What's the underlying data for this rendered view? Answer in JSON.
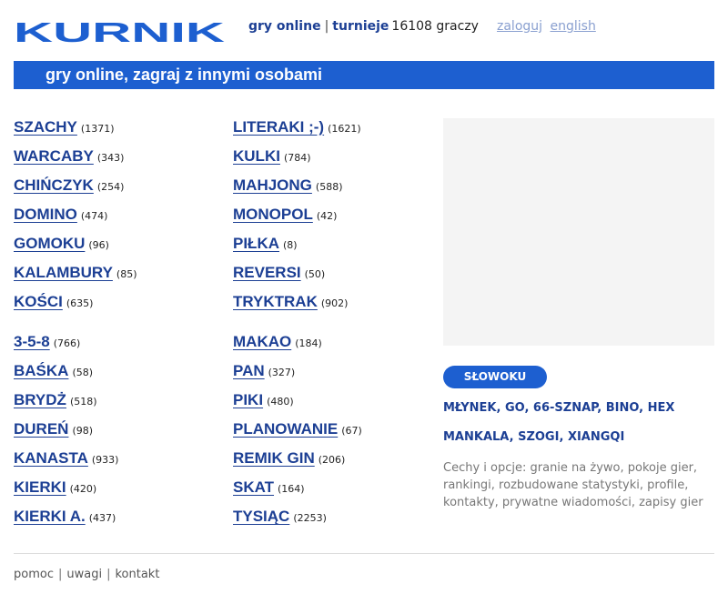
{
  "header": {
    "logo_text": "KURNIK",
    "nav_games": "gry online",
    "nav_separator": "|",
    "nav_tournaments": "turnieje",
    "players_count": "16108 graczy",
    "login": "zaloguj",
    "english": "english"
  },
  "banner": {
    "title": "gry online, zagraj z innymi osobami"
  },
  "games_left": [
    {
      "name": "SZACHY",
      "count": "(1371)"
    },
    {
      "name": "WARCABY",
      "count": "(343)"
    },
    {
      "name": "CHIŃCZYK",
      "count": "(254)"
    },
    {
      "name": "DOMINO",
      "count": "(474)"
    },
    {
      "name": "GOMOKU",
      "count": "(96)"
    },
    {
      "name": "KALAMBURY",
      "count": "(85)"
    },
    {
      "name": "KOŚCI",
      "count": "(635)"
    },
    {
      "name": "3-5-8",
      "count": "(766)"
    },
    {
      "name": "BAŚKA",
      "count": "(58)"
    },
    {
      "name": "BRYDŻ",
      "count": "(518)"
    },
    {
      "name": "DUREŃ",
      "count": "(98)"
    },
    {
      "name": "KANASTA",
      "count": "(933)"
    },
    {
      "name": "KIERKI",
      "count": "(420)"
    },
    {
      "name": "KIERKI A.",
      "count": "(437)"
    }
  ],
  "games_right": [
    {
      "name": "LITERAKI ;-)",
      "count": "(1621)"
    },
    {
      "name": "KULKI",
      "count": "(784)"
    },
    {
      "name": "MAHJONG",
      "count": "(588)"
    },
    {
      "name": "MONOPOL",
      "count": "(42)"
    },
    {
      "name": "PIŁKA",
      "count": "(8)"
    },
    {
      "name": "REVERSI",
      "count": "(50)"
    },
    {
      "name": "TRYKTRAK",
      "count": "(902)"
    },
    {
      "name": "MAKAO",
      "count": "(184)"
    },
    {
      "name": "PAN",
      "count": "(327)"
    },
    {
      "name": "PIKI",
      "count": "(480)"
    },
    {
      "name": "PLANOWANIE",
      "count": "(67)"
    },
    {
      "name": "REMIK GIN",
      "count": "(206)"
    },
    {
      "name": "SKAT",
      "count": "(164)"
    },
    {
      "name": "TYSIĄC",
      "count": "(2253)"
    }
  ],
  "featured": {
    "label": "SŁOWOKU"
  },
  "extra_line1": [
    "MŁYNEK",
    "GO",
    "66-SZNAP",
    "BINO",
    "HEX"
  ],
  "extra_line2": [
    "MANKALA",
    "SZOGI",
    "XIANGQI"
  ],
  "extra_separator": ",",
  "description": "Cechy i opcje: granie na żywo, pokoje gier, rankingi, rozbudowane statystyki, profile, kontakty, prywatne wiadomości, zapisy gier",
  "footer": {
    "links": [
      "pomoc",
      "uwagi",
      "kontakt"
    ],
    "separator": "|"
  },
  "colors": {
    "brand_blue": "#1d5fd0",
    "link_blue": "#1c3f94",
    "muted_link": "#8aa0d0"
  }
}
